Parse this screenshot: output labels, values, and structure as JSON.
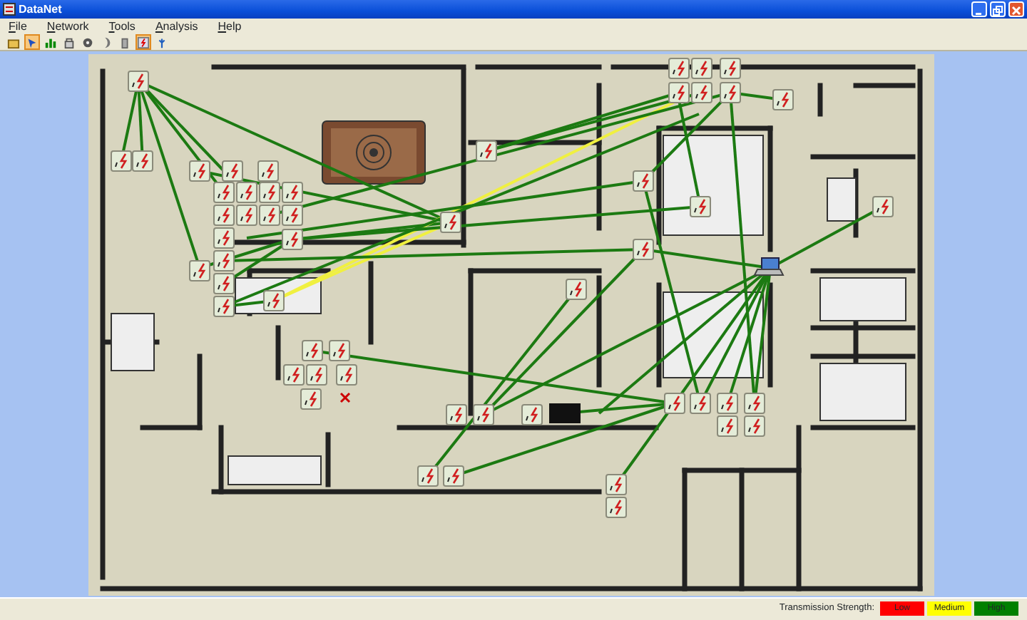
{
  "window": {
    "title": "DataNet"
  },
  "menu": [
    "File",
    "Network",
    "Tools",
    "Analysis",
    "Help"
  ],
  "toolbar": [
    {
      "pressed": false
    },
    {
      "pressed": true
    },
    {
      "pressed": false
    },
    {
      "pressed": false
    },
    {
      "pressed": false
    },
    {
      "pressed": false
    },
    {
      "pressed": false
    },
    {
      "pressed": true
    },
    {
      "pressed": false
    }
  ],
  "status_bar": {
    "label": "Transmission Strength:",
    "legend": [
      {
        "label": "Low",
        "color": "#ff0000"
      },
      {
        "label": "Medium",
        "color": "#ffff00"
      },
      {
        "label": "High",
        "color": "#008000"
      }
    ]
  }
}
